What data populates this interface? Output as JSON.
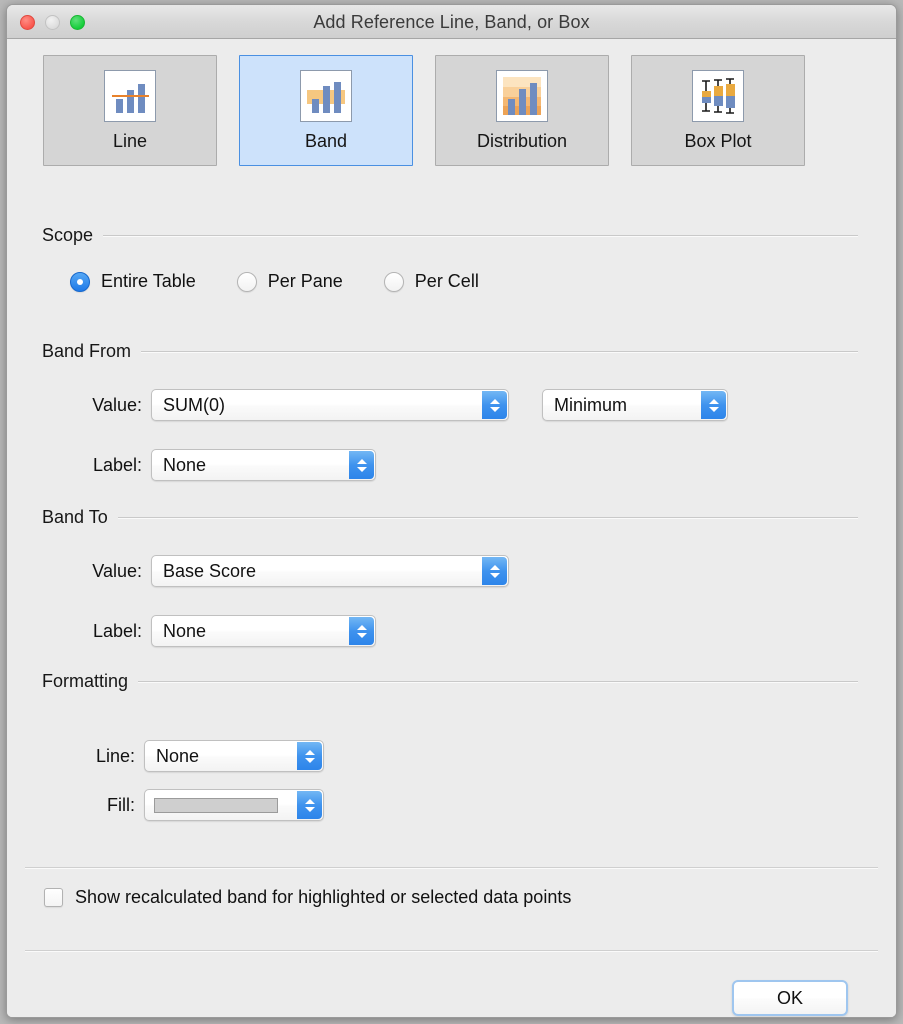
{
  "window": {
    "title": "Add Reference Line, Band, or Box",
    "traffic_lights": [
      {
        "name": "close",
        "color": "#f9564d"
      },
      {
        "name": "minimize",
        "color": "#dcdcdc"
      },
      {
        "name": "zoom",
        "color": "#14cd39"
      }
    ]
  },
  "type_buttons": [
    {
      "label": "Line",
      "icon": "line-chart-icon",
      "selected": false
    },
    {
      "label": "Band",
      "icon": "band-chart-icon",
      "selected": true
    },
    {
      "label": "Distribution",
      "icon": "distribution-chart-icon",
      "selected": false
    },
    {
      "label": "Box Plot",
      "icon": "box-plot-chart-icon",
      "selected": false
    }
  ],
  "scope": {
    "title": "Scope",
    "options": [
      {
        "label": "Entire Table",
        "selected": true
      },
      {
        "label": "Per Pane",
        "selected": false
      },
      {
        "label": "Per Cell",
        "selected": false
      }
    ]
  },
  "band_from": {
    "title": "Band From",
    "value_label": "Value:",
    "value": "SUM(0)",
    "aggregation": "Minimum",
    "label_label": "Label:",
    "label_value": "None"
  },
  "band_to": {
    "title": "Band To",
    "value_label": "Value:",
    "value": "Base Score",
    "label_label": "Label:",
    "label_value": "None"
  },
  "formatting": {
    "title": "Formatting",
    "line_label": "Line:",
    "line_value": "None",
    "fill_label": "Fill:",
    "fill_swatch_color": "#cfcfcf"
  },
  "recalculate": {
    "label": "Show recalculated band for highlighted or selected data points",
    "checked": false
  },
  "footer": {
    "ok_label": "OK"
  },
  "colors": {
    "accent_blue": "#2d85ea",
    "selected_bg": "#cde2fb",
    "selected_border": "#4a90e2",
    "bar_blue": "#6f8cc0",
    "band_orange": "#f6c780",
    "line_orange": "#e8822c",
    "window_bg": "#ececec"
  }
}
